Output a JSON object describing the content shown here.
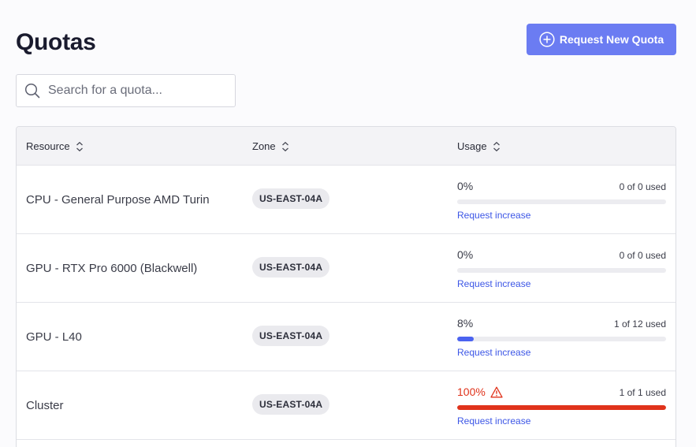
{
  "page": {
    "title": "Quotas",
    "request_button_label": "Request New Quota"
  },
  "search": {
    "placeholder": "Search for a quota...",
    "value": ""
  },
  "table": {
    "columns": {
      "resource": "Resource",
      "zone": "Zone",
      "usage": "Usage"
    },
    "rows": [
      {
        "resource": "CPU - General Purpose AMD Turin",
        "zone": "US-EAST-04A",
        "percent_label": "0%",
        "used_label": "0 of 0 used",
        "fill_fraction": 0.0,
        "link": "Request increase",
        "warning": false
      },
      {
        "resource": "GPU - RTX Pro 6000 (Blackwell)",
        "zone": "US-EAST-04A",
        "percent_label": "0%",
        "used_label": "0 of 0 used",
        "fill_fraction": 0.0,
        "link": "Request increase",
        "warning": false
      },
      {
        "resource": "GPU - L40",
        "zone": "US-EAST-04A",
        "percent_label": "8%",
        "used_label": "1 of 12 used",
        "fill_fraction": 0.08,
        "link": "Request increase",
        "warning": false
      },
      {
        "resource": "Cluster",
        "zone": "US-EAST-04A",
        "percent_label": "100%",
        "used_label": "1 of 1 used",
        "fill_fraction": 1.0,
        "link": "Request increase",
        "warning": true
      }
    ]
  },
  "colors": {
    "accent": "#6b7cf2",
    "progress": "#4b63f0",
    "danger": "#e0331b",
    "link": "#3c56e6"
  },
  "icons": {
    "button": "plus-circle-icon",
    "search": "search-icon",
    "sort": "sort-icon",
    "warning": "warning-triangle-icon"
  }
}
